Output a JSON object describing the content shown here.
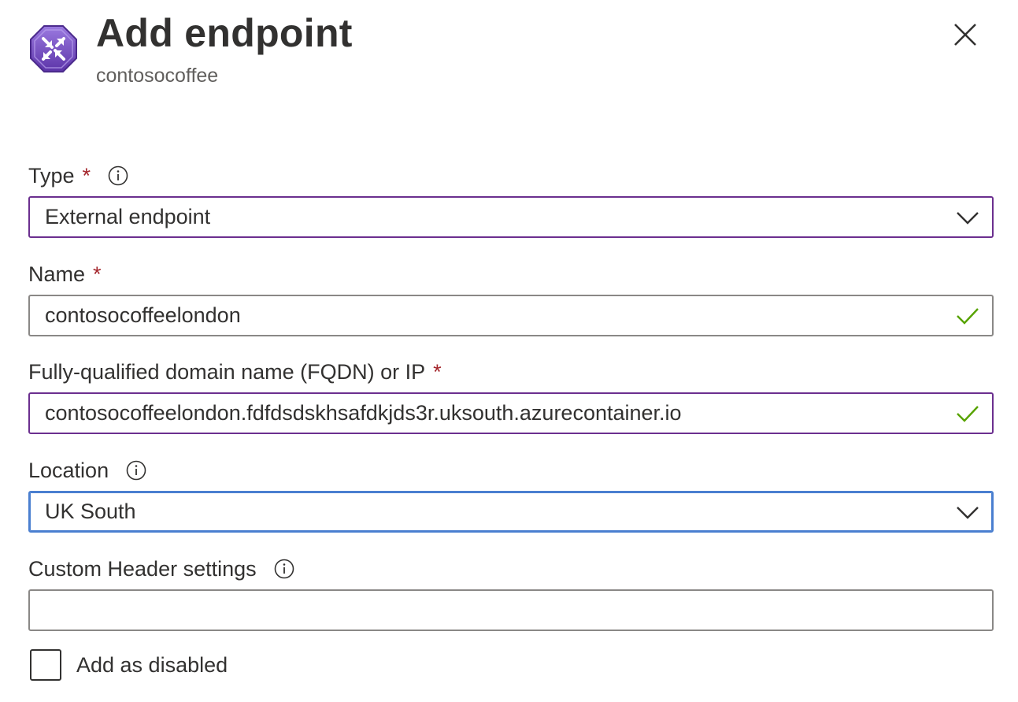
{
  "header": {
    "title": "Add endpoint",
    "subtitle": "contosocoffee",
    "icon": "traffic-manager-endpoint-icon",
    "close_icon": "close-icon"
  },
  "form": {
    "type": {
      "label": "Type",
      "required_mark": "*",
      "value": "External endpoint"
    },
    "name": {
      "label": "Name",
      "required_mark": "*",
      "value": "contosocoffeelondon"
    },
    "fqdn": {
      "label": "Fully-qualified domain name (FQDN) or IP",
      "required_mark": "*",
      "value": "contosocoffeelondon.fdfdsdskhsafdkjds3r.uksouth.azurecontainer.io"
    },
    "location": {
      "label": "Location",
      "value": "UK South"
    },
    "custom_header": {
      "label": "Custom Header settings",
      "value": ""
    },
    "add_disabled": {
      "label": "Add as disabled",
      "checked": false
    }
  },
  "colors": {
    "accent_purple": "#6b2f8f",
    "focus_blue": "#4a7fd0",
    "required_red": "#a4262c",
    "valid_green": "#57a300",
    "icon_purple": "#7b4fc8"
  }
}
